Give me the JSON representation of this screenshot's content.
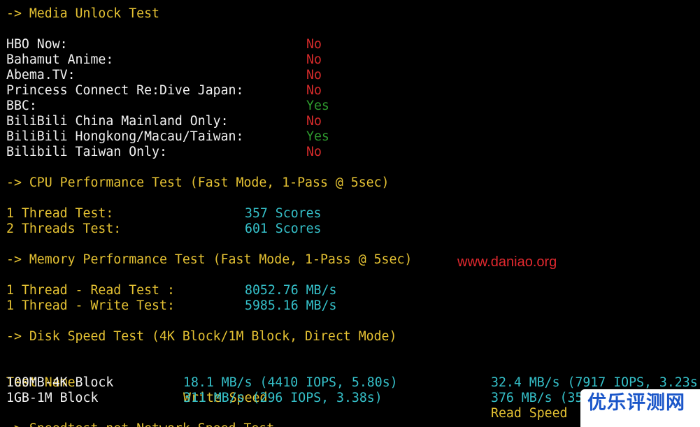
{
  "media": {
    "header": "-> Media Unlock Test",
    "rows": [
      {
        "label": "HBO Now:",
        "result": "No",
        "color": "#d42a2a"
      },
      {
        "label": "Bahamut Anime:",
        "result": "No",
        "color": "#d42a2a"
      },
      {
        "label": "Abema.TV:",
        "result": "No",
        "color": "#d42a2a"
      },
      {
        "label": "Princess Connect Re:Dive Japan:",
        "result": "No",
        "color": "#d42a2a"
      },
      {
        "label": "BBC:",
        "result": "Yes",
        "color": "#2e9b2e"
      },
      {
        "label": "BiliBili China Mainland Only:",
        "result": "No",
        "color": "#d42a2a"
      },
      {
        "label": "BiliBili Hongkong/Macau/Taiwan:",
        "result": "Yes",
        "color": "#2e9b2e"
      },
      {
        "label": "Bilibili Taiwan Only:",
        "result": "No",
        "color": "#d42a2a"
      }
    ]
  },
  "cpu": {
    "header": "-> CPU Performance Test (Fast Mode, 1-Pass @ 5sec)",
    "rows": [
      {
        "label": "1 Thread Test:",
        "value": "357 Scores"
      },
      {
        "label": "2 Threads Test:",
        "value": "601 Scores"
      }
    ]
  },
  "memory": {
    "header": "-> Memory Performance Test (Fast Mode, 1-Pass @ 5sec)",
    "rows": [
      {
        "label": "1 Thread - Read Test :",
        "value": "8052.76 MB/s"
      },
      {
        "label": "1 Thread - Write Test:",
        "value": "5985.16 MB/s"
      }
    ]
  },
  "disk": {
    "header": "-> Disk Speed Test (4K Block/1M Block, Direct Mode)",
    "columns": [
      "Test Name",
      "Write Speed",
      "Read Speed"
    ],
    "rows": [
      {
        "name": "100MB-4K Block",
        "write": "18.1 MB/s (4410 IOPS, 5.80s)",
        "read": "32.4 MB/s (7917 IOPS, 3.23s"
      },
      {
        "name": "1GB-1M Block",
        "write": "311 MB/s (296 IOPS, 3.38s)",
        "read": "376 MB/s (35"
      }
    ]
  },
  "next_header": "-> Speedtest.net Network Speed Test",
  "watermark": {
    "url": "www.daniao.org",
    "brand": "优乐评测网"
  },
  "colors": {
    "background": "#000000",
    "header": "#e5c233",
    "label": "#f2f2f2",
    "no": "#d42a2a",
    "yes": "#2e9b2e",
    "value": "#35c0c9",
    "watermark_url": "#e0282e",
    "watermark_brand": "#1a56c9"
  }
}
